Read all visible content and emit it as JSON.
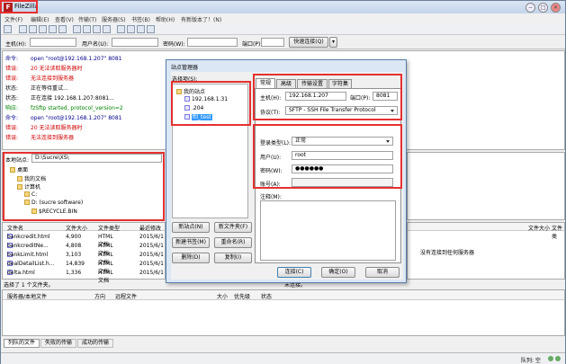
{
  "app": {
    "title": "FileZilla"
  },
  "window_buttons": [
    "−",
    "□",
    "✕"
  ],
  "menu": [
    "文件(F)",
    "编辑(E)",
    "查看(V)",
    "传输(T)",
    "服务器(S)",
    "书签(B)",
    "帮助(H)",
    "有新版本了！(N)"
  ],
  "quickconnect": {
    "host_label": "主机(H):",
    "user_label": "用户名(U):",
    "pass_label": "密码(W):",
    "port_label": "端口(P):",
    "connect_label": "快速连接(Q)"
  },
  "log": [
    {
      "k": "命令:",
      "t": "open \"root@192.168.1.207\" 8081",
      "c": "blue"
    },
    {
      "k": "错误:",
      "t": "20 无法读取服务器时",
      "c": "red"
    },
    {
      "k": "错误:",
      "t": "无法连接到服务器",
      "c": "red"
    },
    {
      "k": "状态:",
      "t": "正在等待重试...",
      "c": "black"
    },
    {
      "k": "状态:",
      "t": "正在连接 192.168.1.207:8081...",
      "c": "black"
    },
    {
      "k": "响应:",
      "t": "fzSftp started, protocol_version=2",
      "c": "green"
    },
    {
      "k": "命令:",
      "t": "open \"root@192.168.1.207\" 8081",
      "c": "blue"
    },
    {
      "k": "错误:",
      "t": "20 无法读取服务器时",
      "c": "red"
    },
    {
      "k": "错误:",
      "t": "无法连接到服务器",
      "c": "red"
    }
  ],
  "local": {
    "site_label": "本地站点:",
    "path": "D:\\Sucre\\XS\\",
    "tree": [
      {
        "label": "桌面",
        "indent": 0
      },
      {
        "label": "我的文档",
        "indent": 1
      },
      {
        "label": "计算机",
        "indent": 1
      },
      {
        "label": "C:",
        "indent": 2
      },
      {
        "label": "D: (sucre software)",
        "indent": 2
      },
      {
        "label": "$RECYCLE.BIN",
        "indent": 3
      }
    ],
    "columns": [
      "文件名",
      "文件大小",
      "文件类型",
      "最近修改"
    ],
    "files": [
      [
        "bankcredit.html",
        "4,900",
        "HTML 文档",
        "2015/6/1"
      ],
      [
        "bankcreditNe...",
        "4,808",
        "HTML 文档",
        "2015/6/1"
      ],
      [
        "bankLimit.html",
        "3,103",
        "HTML 文档",
        "2015/6/1"
      ],
      [
        "dealDetailList.h...",
        "14,839",
        "HTML 文档",
        "2015/6/1"
      ],
      [
        "delta.html",
        "1,336",
        "HTML 文档",
        "2015/6/1"
      ]
    ],
    "status": "选择了 1 个文件夹。"
  },
  "remote": {
    "columns": [
      "文件大小",
      "文件类"
    ],
    "message": "没有连接到任何服务器",
    "status": "未连接。"
  },
  "queue": {
    "columns": [
      "服务器/本地文件",
      "方向",
      "远程文件",
      "大小",
      "优先级",
      "状态"
    ],
    "tabs": [
      "列队的文件",
      "失败的传输",
      "成功的传输"
    ],
    "queue_label": "队列: 空"
  },
  "site_manager": {
    "title": "站点管理器",
    "select_entry_label": "选择项(S):",
    "root": "我的站点",
    "sites": [
      "192.168.1.31",
      ".204",
      "ftl_test"
    ],
    "buttons": {
      "new_site": "新站点(N)",
      "new_folder": "新文件夹(F)",
      "new_bookmark": "新建书签(M)",
      "rename": "重命名(R)",
      "delete": "删除(D)",
      "copy": "复制(I)",
      "connect": "连接(C)",
      "ok": "确定(O)",
      "cancel": "取消"
    },
    "tabs": [
      "常规",
      "高级",
      "传输设置",
      "字符集"
    ],
    "host_label": "主机(H):",
    "host": "192.168.1.207",
    "port_label": "端口(P):",
    "port": "8081",
    "protocol_label": "协议(T):",
    "protocol": "SFTP - SSH File Transfer Protocol",
    "logon_label": "登录类型(L):",
    "logon": "正常",
    "user_label": "用户(U):",
    "user": "root",
    "password_label": "密码(W):",
    "password": "●●●●●●",
    "account_label": "账号(A):",
    "account": "",
    "comments_label": "注释(M):"
  }
}
